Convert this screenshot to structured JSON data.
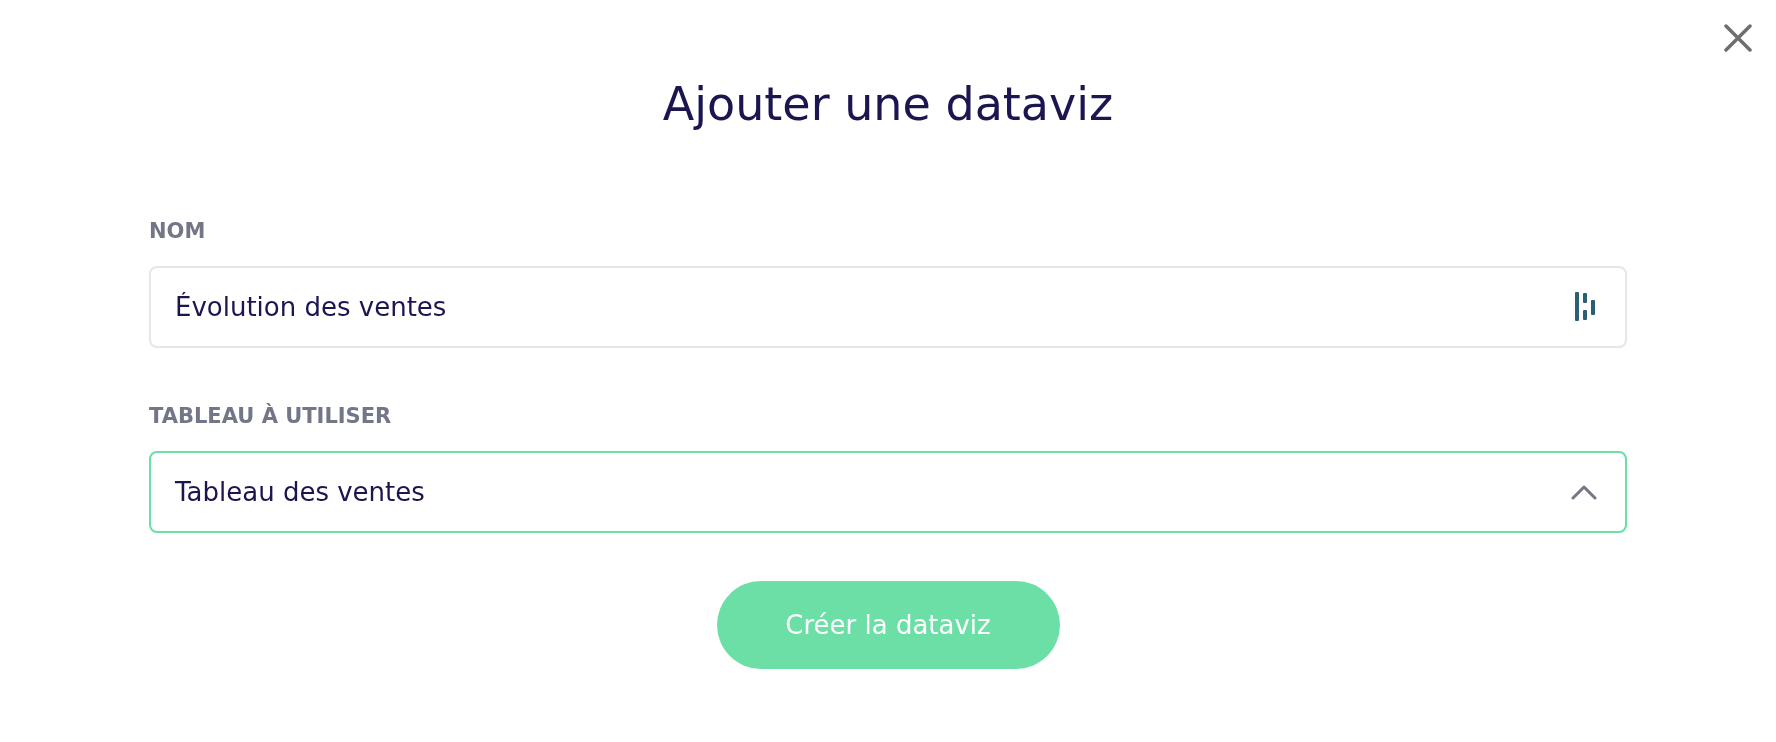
{
  "dialog": {
    "title": "Ajouter une dataviz"
  },
  "fields": [
    {
      "kind": "text",
      "label": "NOM",
      "value": "Évolution des ventes"
    },
    {
      "kind": "select",
      "label": "TABLEAU À UTILISER",
      "value": "Tableau des ventes",
      "expanded": true
    }
  ],
  "submit_button": {
    "label": "Créer la dataviz"
  }
}
